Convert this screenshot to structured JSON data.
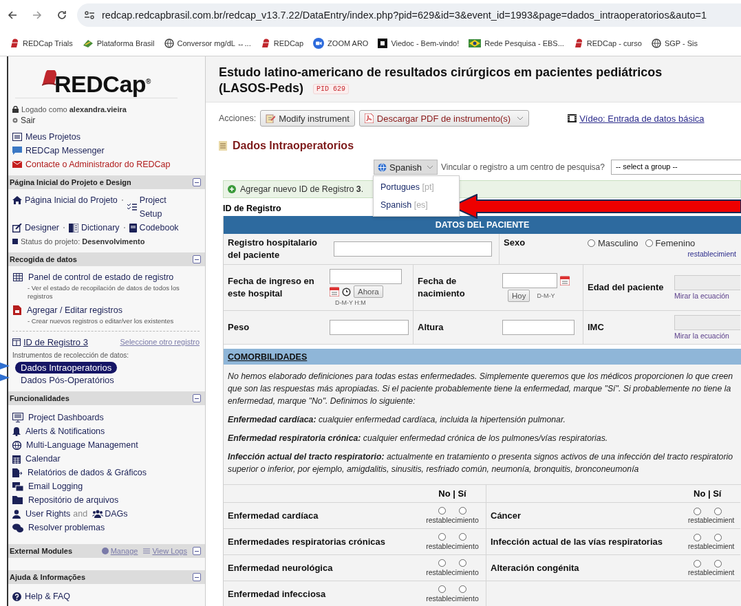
{
  "browser": {
    "url": "redcap.redcapbrasil.com.br/redcap_v13.7.22/DataEntry/index.php?pid=629&id=3&event_id=1993&page=dados_intraoperatorios&auto=1",
    "bookmarks": [
      {
        "label": "REDCap Trials"
      },
      {
        "label": "Plataforma Brasil"
      },
      {
        "label": "Conversor mg/dL ↔..."
      },
      {
        "label": "REDCap"
      },
      {
        "label": "ZOOM ARO"
      },
      {
        "label": "Viedoc - Bem-vindo!"
      },
      {
        "label": "Rede Pesquisa - EBS..."
      },
      {
        "label": "REDCap - curso"
      },
      {
        "label": "SGP - Sis"
      }
    ]
  },
  "sidebar": {
    "logo": "REDCap$^{®}$",
    "logged_in": "Logado como **alexandra.vieira**",
    "logout": "Sair",
    "links": [
      {
        "label": "Meus Projetos",
        "kind": "link"
      },
      {
        "label": "REDCap Messenger",
        "kind": "link"
      },
      {
        "label": "Contacte o Administrador do REDCap",
        "kind": "alert"
      }
    ],
    "project_section": {
      "title": "Página Inicial do Projeto e Design",
      "expanded": true,
      "lines": [
        [
          "Página Inicial do Projeto",
          "Project Setup"
        ],
        [
          "Designer",
          "Dictionary",
          "Codebook"
        ]
      ],
      "status": "Status do projeto: **Desenvolvimento**"
    },
    "collection_section": {
      "title": "Recogida de datos",
      "expanded": true,
      "items": [
        {
          "label": "Panel de control de estado de registro",
          "note": "- Ver el estado de recopilación de datos de todos los registros"
        },
        {
          "label": "Agregar / Editar registros",
          "note": "- Crear nuevos registros o editar/ver los existentes"
        }
      ],
      "record": "ID de Registro 3",
      "other_record": "Seleccione otro registro",
      "instruments_label": "Instrumentos de recolección de datos:",
      "instruments": [
        {
          "label": "Dados Intraoperatorios",
          "selected": true
        },
        {
          "label": "Dados Pós-Operatórios",
          "selected": false
        }
      ]
    },
    "features_section": {
      "title": "Funcionalidades",
      "expanded": true,
      "items": [
        {
          "kind": "link",
          "label": "Project Dashboards"
        },
        {
          "kind": "link",
          "label": "Alerts & Notifications"
        },
        {
          "kind": "link",
          "label": "Multi-Language Management"
        },
        {
          "kind": "link",
          "label": "Calendar"
        },
        {
          "kind": "link",
          "label": "Relatórios de dados & Gráficos"
        },
        {
          "kind": "link",
          "label": "Email Logging"
        },
        {
          "kind": "link",
          "label": "Repositório de arquivos"
        },
        {
          "kind": "pair",
          "label": "User Rights",
          "joiner": "and",
          "label2": "DAGs"
        },
        {
          "kind": "link",
          "label": "Resolver problemas"
        }
      ]
    },
    "external_section": {
      "title": "External Modules",
      "expanded": true,
      "links": [
        "Manage",
        "View Logs"
      ]
    },
    "help_section": {
      "title": "Ajuda & Informações",
      "expanded": true,
      "items": [
        "Help & FAQ"
      ]
    }
  },
  "project": {
    "title": "Estudo latino-americano de resultados cirúrgicos em pacientes pediátricos (LASOS-Peds)",
    "pid": "PID 629"
  },
  "actions": {
    "label": "Acciones:",
    "buttons": [
      {
        "label": "Modify instrument",
        "dropdown": false
      },
      {
        "label": "Descargar PDF de instrumento(s)",
        "dropdown": true
      }
    ],
    "video_link": "Vídeo: Entrada de datos básica"
  },
  "form": {
    "title": "Dados Intraoperatorios",
    "language": {
      "label": "Spanish",
      "expanded": true,
      "options": [
        {
          "label": "Portugues",
          "code": "[pt]",
          "selected": false
        },
        {
          "label": "Spanish",
          "code": "[es]",
          "selected": false
        }
      ]
    },
    "dag": {
      "label": "Vincular o registro a um centro de pesquisa?",
      "value": "-- select a group --"
    },
    "notice": "Agregar nuevo ID de Registro **3**.",
    "record_label": "ID de Registro",
    "patient": {
      "header": "DATOS DEL PACIENTE",
      "rows": [
        [
          {
            "kind": "text",
            "label": "Registro hospitalario del paciente"
          },
          {
            "kind": "radio",
            "label": "Sexo",
            "options": [
              {
                "label": "Masculino",
                "checked": false
              },
              {
                "label": "Femenino",
                "checked": false
              }
            ],
            "reset": "restablecimient"
          }
        ],
        [
          {
            "kind": "datetime",
            "label": "Fecha de ingreso en este hospital",
            "button": "Ahora",
            "format": "D-M-Y H:M"
          },
          {
            "kind": "date",
            "label": "Fecha de nacimiento",
            "button": "Hoy",
            "format": "D-M-Y"
          },
          {
            "kind": "calc",
            "label": "Edad del paciente",
            "link": "Mirar la ecuación"
          }
        ],
        [
          {
            "kind": "text",
            "label": "Peso"
          },
          {
            "kind": "text",
            "label": "Altura"
          },
          {
            "kind": "calc",
            "label": "IMC",
            "link": "Mirar la ecuación"
          }
        ]
      ]
    },
    "comorbidities": {
      "header": "COMORBILIDADES",
      "intro": "No hemos elaborado definiciones para todas estas enfermedades. Simplemente queremos que los médicos proporcionen lo que creen que son las respuestas más apropiadas. Si el paciente probablemente tiene la enfermedad, marque \"Sí\". Si probablemente no tiene la enfermedad, marque \"No\". Definimos lo siguiente:",
      "definitions": [
        "**Enfermedad cardíaca:** cualquier enfermedad cardíaca, incluida la hipertensión pulmonar.",
        "**Enfermedad respiratoria crónica:** cualquier enfermedad crónica de los pulmones/vías respiratorias.",
        "**Infección actual del tracto respiratorio:** actualmente en tratamiento o presenta signos activos de una infección del tracto respiratorio superior o inferior, por ejemplo, amigdalitis, sinusitis, resfriado común, neumonía, bronquitis, bronconeumonía"
      ],
      "headers": [
        "No | Sí",
        "No | Sí"
      ],
      "left": [
        {
          "label": "Enfermedad cardíaca",
          "radios": [
            {
              "checked": false
            },
            {
              "checked": false
            }
          ],
          "reset": "restablecimiento"
        },
        {
          "label": "Enfermedades respiratorias crónicas",
          "radios": [
            {
              "checked": false
            },
            {
              "checked": false
            }
          ],
          "reset": "restablecimiento"
        },
        {
          "label": "Enfermedad neurológica",
          "radios": [
            {
              "checked": false
            },
            {
              "checked": false
            }
          ],
          "reset": "restablecimiento"
        },
        {
          "label": "Enfermedad infecciosa",
          "radios": [
            {
              "checked": false
            },
            {
              "checked": false
            }
          ],
          "reset": "restablecimiento"
        }
      ],
      "right": [
        {
          "label": "Cáncer",
          "radios": [
            {
              "checked": false
            },
            {
              "checked": false
            }
          ],
          "reset": "restablecimient"
        },
        {
          "label": "Infección actual de las vías respiratorias",
          "radios": [
            {
              "checked": false
            },
            {
              "checked": false
            }
          ],
          "reset": "restablecimient"
        },
        {
          "label": "Alteración congénita",
          "radios": [
            {
              "checked": false
            },
            {
              "checked": false
            }
          ],
          "reset": "restablecimient"
        }
      ]
    }
  }
}
